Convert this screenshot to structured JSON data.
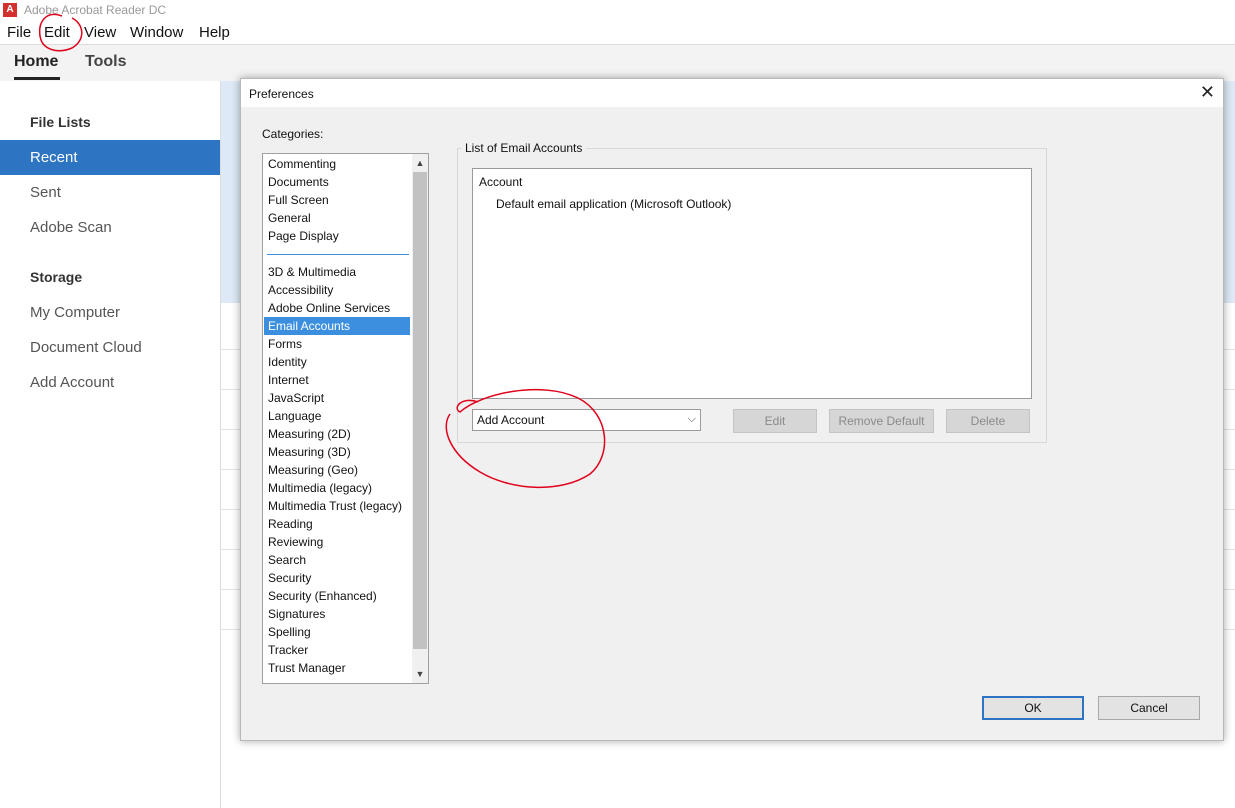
{
  "app": {
    "title": "Adobe Acrobat Reader DC",
    "logo_glyph": "A"
  },
  "menu": [
    "File",
    "Edit",
    "View",
    "Window",
    "Help"
  ],
  "tabs": [
    "Home",
    "Tools"
  ],
  "sidebar": {
    "file_lists_heading": "File Lists",
    "file_items": [
      "Recent",
      "Sent",
      "Adobe Scan"
    ],
    "storage_heading": "Storage",
    "storage_items": [
      "My Computer",
      "Document Cloud",
      "Add Account"
    ]
  },
  "dialog": {
    "title": "Preferences",
    "close_glyph": "✕",
    "categories_label": "Categories:",
    "categories_top": [
      "Commenting",
      "Documents",
      "Full Screen",
      "General",
      "Page Display"
    ],
    "categories": [
      "3D & Multimedia",
      "Accessibility",
      "Adobe Online Services",
      "Email Accounts",
      "Forms",
      "Identity",
      "Internet",
      "JavaScript",
      "Language",
      "Measuring (2D)",
      "Measuring (3D)",
      "Measuring (Geo)",
      "Multimedia (legacy)",
      "Multimedia Trust (legacy)",
      "Reading",
      "Reviewing",
      "Search",
      "Security",
      "Security (Enhanced)",
      "Signatures",
      "Spelling",
      "Tracker",
      "Trust Manager"
    ],
    "selected_category": "Email Accounts",
    "group_label": "List of Email Accounts",
    "list_column": "Account",
    "list_rows": [
      "Default email application (Microsoft Outlook)"
    ],
    "add_select": {
      "value": "Add Account",
      "arrow": "⌵"
    },
    "buttons": {
      "edit": "Edit",
      "remove_default": "Remove Default",
      "delete": "Delete",
      "ok": "OK",
      "cancel": "Cancel"
    },
    "scroll_up": "▲",
    "scroll_down": "▼"
  },
  "colors": {
    "accent": "#2d74c3",
    "annotation": "#e0001a",
    "selection": "#3c8fdf"
  }
}
